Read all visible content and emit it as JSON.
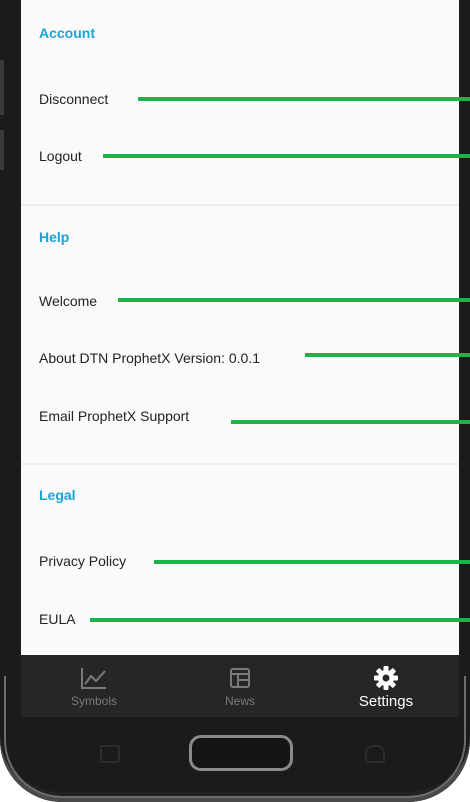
{
  "sections": {
    "account": {
      "title": "Account",
      "items": [
        "Disconnect",
        "Logout"
      ]
    },
    "help": {
      "title": "Help",
      "items": [
        "Welcome",
        "About DTN ProphetX Version: 0.0.1",
        "Email ProphetX Support"
      ]
    },
    "legal": {
      "title": "Legal",
      "items": [
        "Privacy Policy",
        "EULA"
      ]
    }
  },
  "bottom_nav": {
    "tabs": [
      {
        "label": "Symbols",
        "icon": "chart-line-icon",
        "active": false
      },
      {
        "label": "News",
        "icon": "newspaper-icon",
        "active": false
      },
      {
        "label": "Settings",
        "icon": "gear-icon",
        "active": true
      }
    ]
  },
  "colors": {
    "accent": "#1aa3d8",
    "callout": "#1cb34b",
    "nav_background": "#262626"
  }
}
